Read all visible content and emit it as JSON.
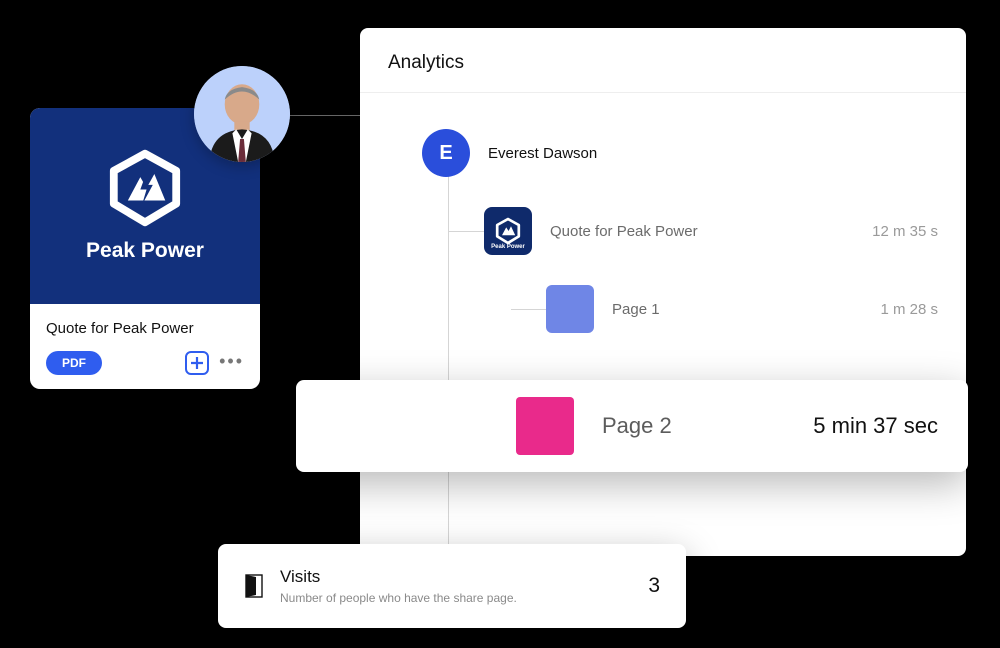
{
  "document_card": {
    "brand_name": "Peak Power",
    "title": "Quote for Peak Power",
    "file_type_label": "PDF"
  },
  "analytics": {
    "heading": "Analytics",
    "viewer": {
      "initial": "E",
      "name": "Everest Dawson"
    },
    "items": [
      {
        "label": "Quote for Peak Power",
        "time": "12 m 35 s",
        "icon": "peak-power-mini",
        "color": "#0f2a6b"
      },
      {
        "label": "Page 1",
        "time": "1 m 28 s",
        "icon": "square",
        "color": "#6f86e6"
      },
      {
        "label": "Page 2",
        "time": "5 min 37 sec",
        "icon": "square",
        "color": "#e92a8b",
        "highlighted": true
      }
    ]
  },
  "visits_card": {
    "title": "Visits",
    "subtitle": "Number of people who have the share page.",
    "count": "3"
  }
}
